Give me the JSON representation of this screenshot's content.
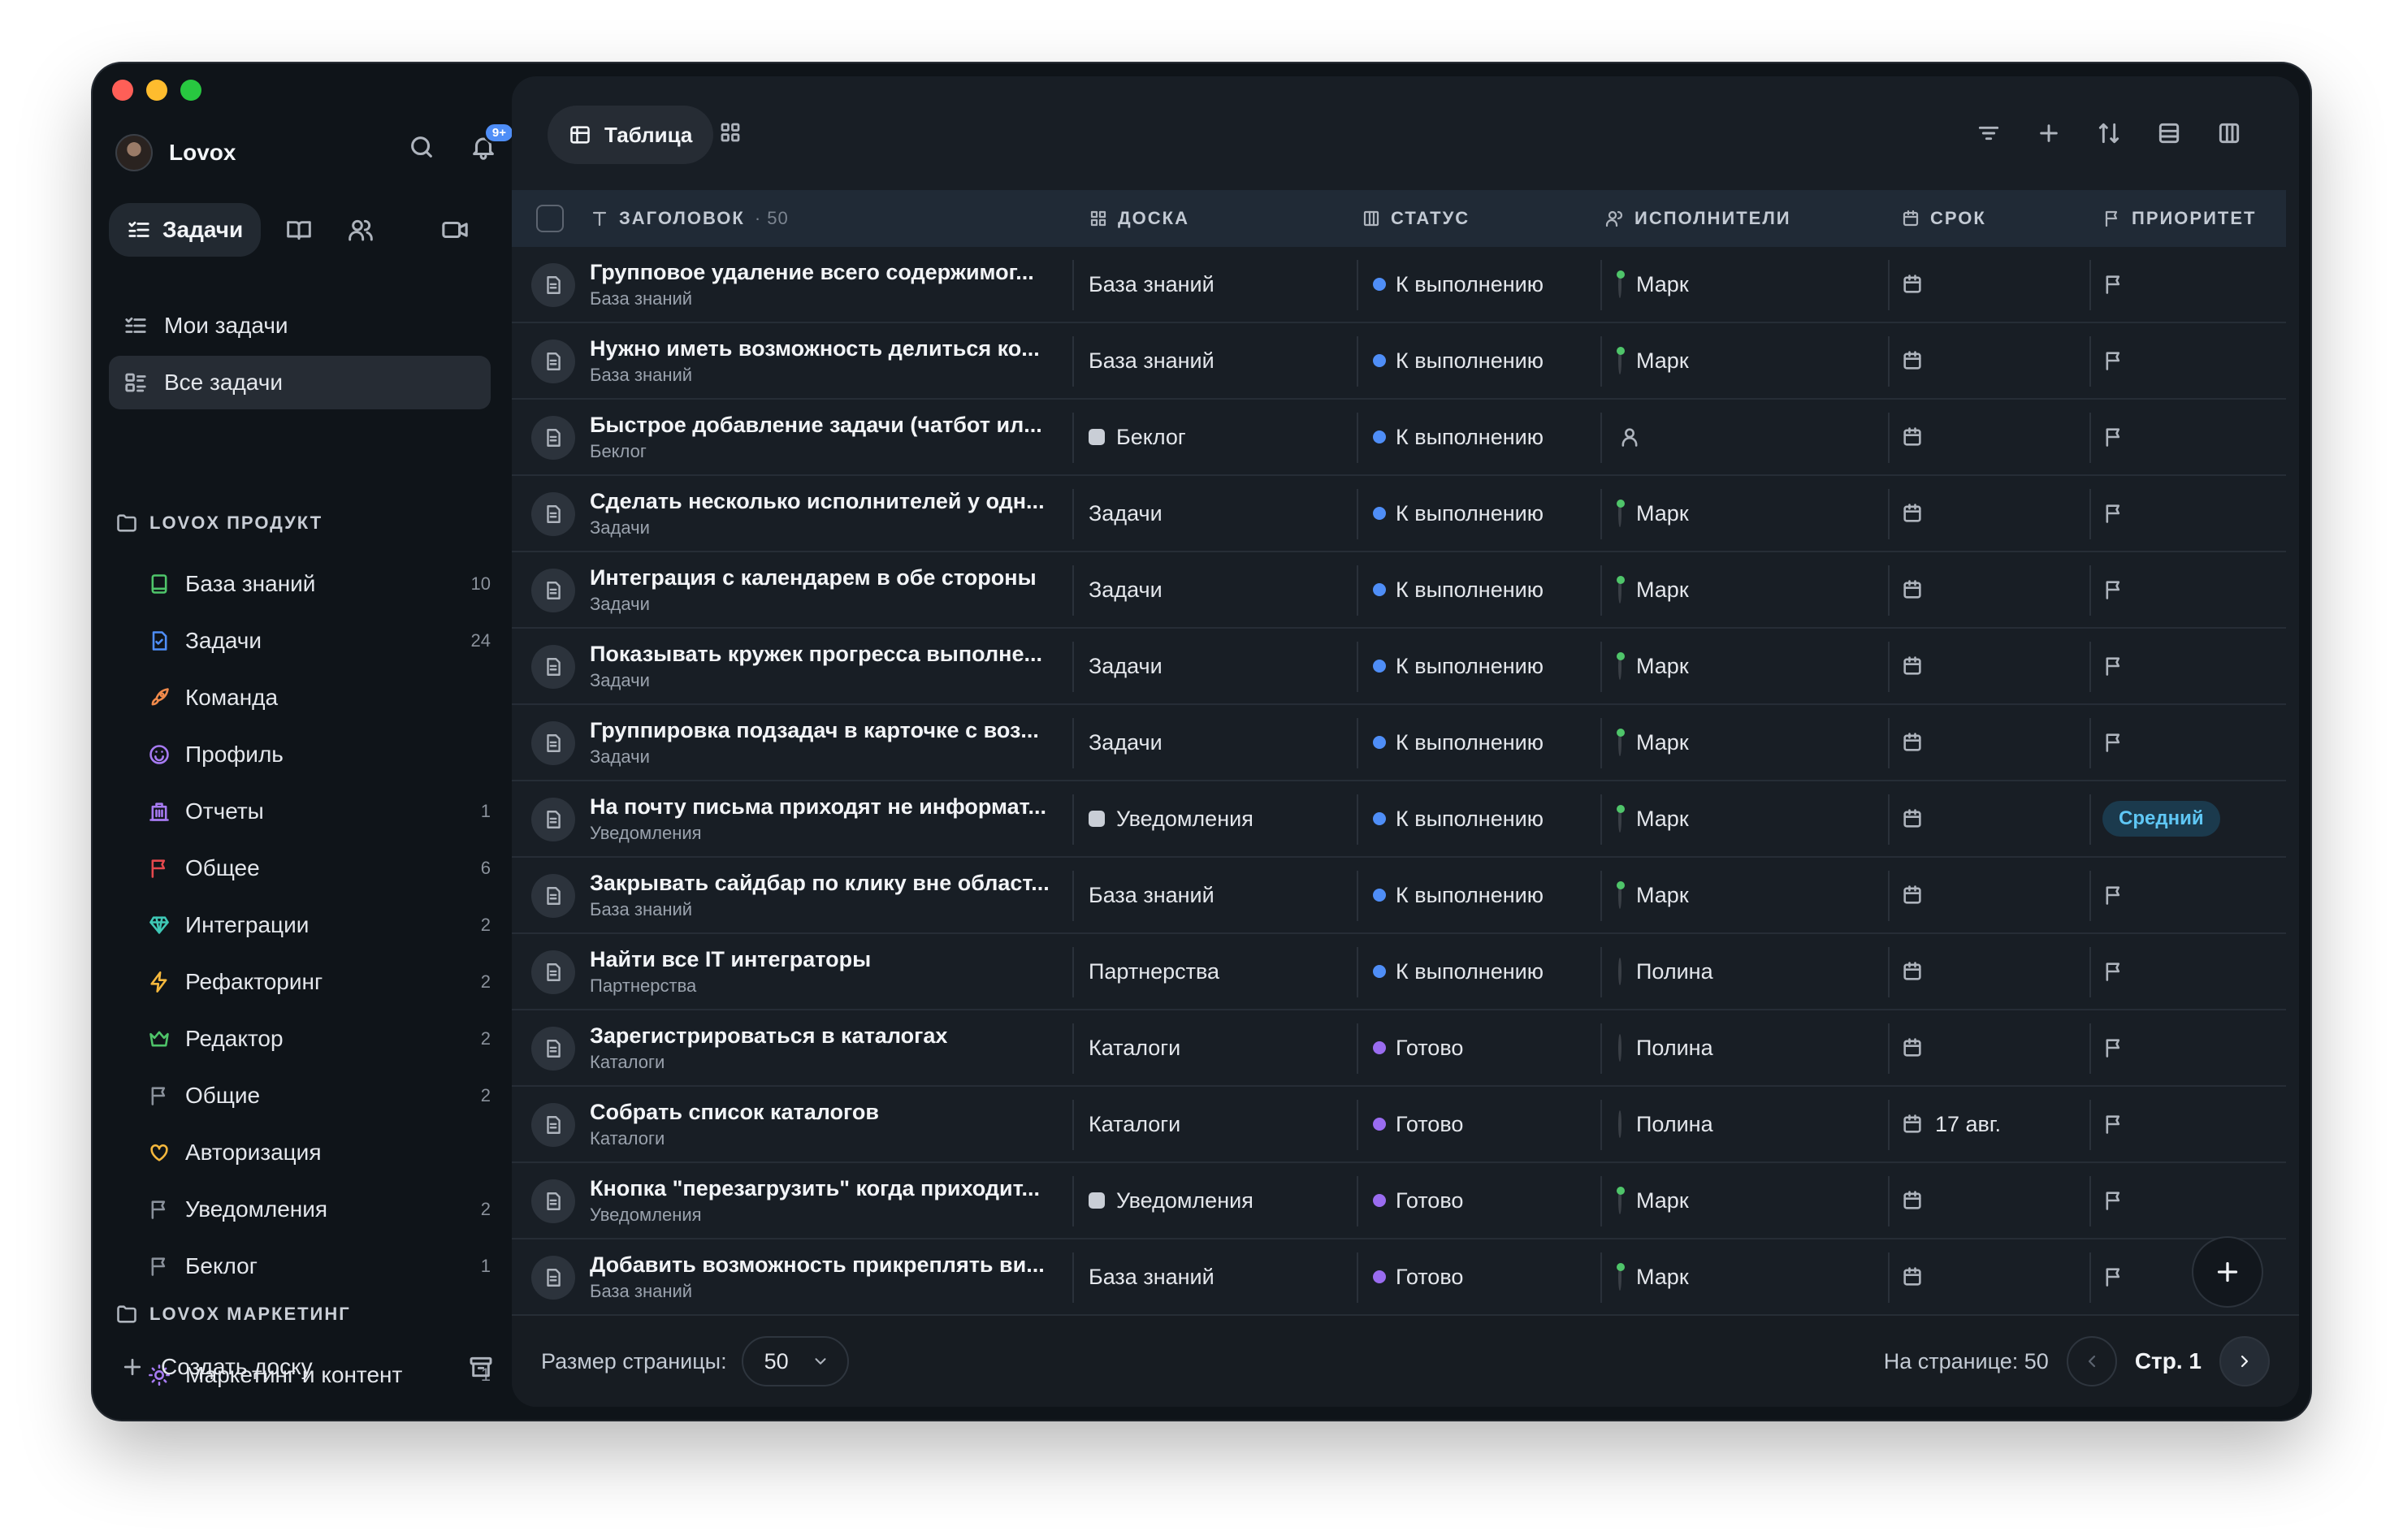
{
  "app": {
    "workspace_name": "Lovox",
    "notification_badge": "9+"
  },
  "sidebar": {
    "tabs": [
      {
        "label": "Задачи",
        "icon": "tasks-icon"
      }
    ],
    "nav": [
      {
        "label": "Мои задачи",
        "icon": "list-icon"
      },
      {
        "label": "Все задачи",
        "icon": "all-tasks-icon",
        "active": true
      }
    ],
    "sections": [
      {
        "title": "LOVOX ПРОДУКТ",
        "boards": [
          {
            "label": "База знаний",
            "count": "10",
            "icon": "book-icon",
            "color": "#4fc56a"
          },
          {
            "label": "Задачи",
            "count": "24",
            "icon": "doc-icon",
            "color": "#4f8ef7"
          },
          {
            "label": "Команда",
            "count": "",
            "icon": "rocket-icon",
            "color": "#f08a4b"
          },
          {
            "label": "Профиль",
            "count": "",
            "icon": "smile-icon",
            "color": "#a77bf3"
          },
          {
            "label": "Отчеты",
            "count": "1",
            "icon": "building-icon",
            "color": "#a77bf3"
          },
          {
            "label": "Общее",
            "count": "6",
            "icon": "flag-icon",
            "color": "#e5484d"
          },
          {
            "label": "Интеграции",
            "count": "2",
            "icon": "diamond-icon",
            "color": "#3fc8b6"
          },
          {
            "label": "Рефакторинг",
            "count": "2",
            "icon": "bolt-icon",
            "color": "#f5b83d"
          },
          {
            "label": "Редактор",
            "count": "2",
            "icon": "crown-icon",
            "color": "#4fc56a"
          },
          {
            "label": "Общие",
            "count": "2",
            "icon": "flag-icon",
            "color": "#8a919b"
          },
          {
            "label": "Авторизация",
            "count": "",
            "icon": "heart-icon",
            "color": "#f5b83d"
          },
          {
            "label": "Уведомления",
            "count": "2",
            "icon": "flag-icon",
            "color": "#8a919b"
          },
          {
            "label": "Беклог",
            "count": "1",
            "icon": "flag-icon",
            "color": "#8a919b"
          }
        ]
      },
      {
        "title": "LOVOX МАРКЕТИНГ",
        "boards": [
          {
            "label": "Маркетинг и контент",
            "count": "1",
            "icon": "sun-icon",
            "color": "#a77bf3"
          }
        ]
      }
    ],
    "create_board": "Создать доску"
  },
  "main": {
    "view_tab": "Таблица",
    "columns": {
      "title": "ЗАГОЛОВОК",
      "title_count": "· 50",
      "board": "ДОСКА",
      "status": "СТАТУС",
      "assignees": "ИСПОЛНИТЕЛИ",
      "due": "СРОК",
      "priority": "ПРИОРИТЕТ"
    },
    "rows": [
      {
        "title": "Групповое удаление всего содержимог...",
        "subtitle": "База знаний",
        "board": "База знаний",
        "board_dot": false,
        "status": "К выполнению",
        "status_color": "#4f8ef7",
        "assignee": "Марк",
        "assignee_female": false,
        "due": "",
        "priority": ""
      },
      {
        "title": "Нужно иметь возможность делиться ко...",
        "subtitle": "База знаний",
        "board": "База знаний",
        "board_dot": false,
        "status": "К выполнению",
        "status_color": "#4f8ef7",
        "assignee": "Марк",
        "assignee_female": false,
        "due": "",
        "priority": ""
      },
      {
        "title": "Быстрое добавление задачи (чатбот ил...",
        "subtitle": "Беклог",
        "board": "Беклог",
        "board_dot": true,
        "status": "К выполнению",
        "status_color": "#4f8ef7",
        "assignee": "",
        "assignee_female": false,
        "due": "",
        "priority": ""
      },
      {
        "title": "Сделать несколько исполнителей у одн...",
        "subtitle": "Задачи",
        "board": "Задачи",
        "board_dot": false,
        "status": "К выполнению",
        "status_color": "#4f8ef7",
        "assignee": "Марк",
        "assignee_female": false,
        "due": "",
        "priority": ""
      },
      {
        "title": "Интеграция с календарем в обе стороны",
        "subtitle": "Задачи",
        "board": "Задачи",
        "board_dot": false,
        "status": "К выполнению",
        "status_color": "#4f8ef7",
        "assignee": "Марк",
        "assignee_female": false,
        "due": "",
        "priority": ""
      },
      {
        "title": "Показывать кружек прогресса выполне...",
        "subtitle": "Задачи",
        "board": "Задачи",
        "board_dot": false,
        "status": "К выполнению",
        "status_color": "#4f8ef7",
        "assignee": "Марк",
        "assignee_female": false,
        "due": "",
        "priority": ""
      },
      {
        "title": "Группировка подзадач в карточке с воз...",
        "subtitle": "Задачи",
        "board": "Задачи",
        "board_dot": false,
        "status": "К выполнению",
        "status_color": "#4f8ef7",
        "assignee": "Марк",
        "assignee_female": false,
        "due": "",
        "priority": ""
      },
      {
        "title": "На почту письма приходят не информат...",
        "subtitle": "Уведомления",
        "board": "Уведомления",
        "board_dot": true,
        "status": "К выполнению",
        "status_color": "#4f8ef7",
        "assignee": "Марк",
        "assignee_female": false,
        "due": "",
        "priority": "Средний"
      },
      {
        "title": "Закрывать сайдбар по клику вне област...",
        "subtitle": "База знаний",
        "board": "База знаний",
        "board_dot": false,
        "status": "К выполнению",
        "status_color": "#4f8ef7",
        "assignee": "Марк",
        "assignee_female": false,
        "due": "",
        "priority": ""
      },
      {
        "title": "Найти все IT интеграторы",
        "subtitle": "Партнерства",
        "board": "Партнерства",
        "board_dot": false,
        "status": "К выполнению",
        "status_color": "#4f8ef7",
        "assignee": "Полина",
        "assignee_female": true,
        "due": "",
        "priority": ""
      },
      {
        "title": "Зарегистрироваться в каталогах",
        "subtitle": "Каталоги",
        "board": "Каталоги",
        "board_dot": false,
        "status": "Готово",
        "status_color": "#9a6cf0",
        "assignee": "Полина",
        "assignee_female": true,
        "due": "",
        "priority": ""
      },
      {
        "title": "Собрать список каталогов",
        "subtitle": "Каталоги",
        "board": "Каталоги",
        "board_dot": false,
        "status": "Готово",
        "status_color": "#9a6cf0",
        "assignee": "Полина",
        "assignee_female": true,
        "due": "17 авг.",
        "priority": ""
      },
      {
        "title": "Кнопка \"перезагрузить\" когда приходит...",
        "subtitle": "Уведомления",
        "board": "Уведомления",
        "board_dot": true,
        "status": "Готово",
        "status_color": "#9a6cf0",
        "assignee": "Марк",
        "assignee_female": false,
        "due": "",
        "priority": ""
      },
      {
        "title": "Добавить возможность прикреплять ви...",
        "subtitle": "База знаний",
        "board": "База знаний",
        "board_dot": false,
        "status": "Готово",
        "status_color": "#9a6cf0",
        "assignee": "Марк",
        "assignee_female": false,
        "due": "",
        "priority": ""
      }
    ]
  },
  "footer": {
    "page_size_label": "Размер страницы:",
    "page_size_value": "50",
    "per_page_label": "На странице: 50",
    "page_label": "Стр. 1"
  }
}
